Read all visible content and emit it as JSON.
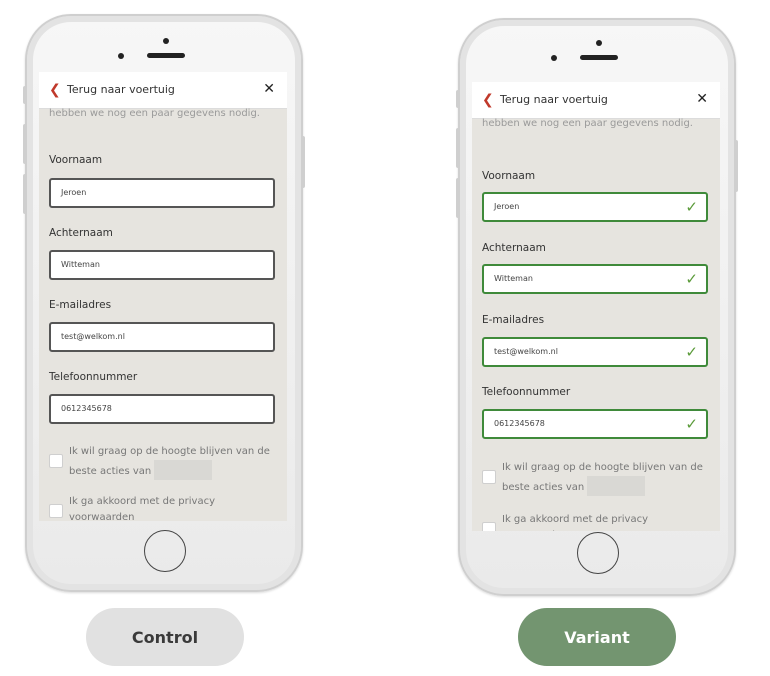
{
  "header": {
    "back_label": "Terug naar voertuig",
    "close": "✕",
    "back_chevron": "❮"
  },
  "intro_text": "hebben we nog een paar gegevens nodig.",
  "fields": [
    {
      "label": "Voornaam",
      "value": "Jeroen"
    },
    {
      "label": "Achternaam",
      "value": "Witteman"
    },
    {
      "label": "E-mailadres",
      "value": "test@welkom.nl"
    },
    {
      "label": "Telefoonnummer",
      "value": "0612345678"
    }
  ],
  "checkboxes": [
    {
      "text_part1": "Ik wil graag op de hoogte blijven van de",
      "text_part2": "beste acties van"
    },
    {
      "text_part1": "Ik ga akkoord met de privacy",
      "text_part2": "voorwaarden"
    }
  ],
  "valid_icon": "✓",
  "buttons": {
    "control": "Control",
    "variant": "Variant"
  },
  "colors": {
    "accent_green": "#739570",
    "check_green": "#5b9b3a",
    "back_red": "#c0392b"
  }
}
